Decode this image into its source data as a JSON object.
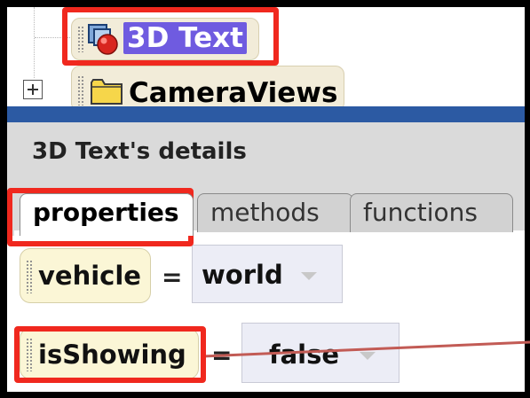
{
  "tree": {
    "items": [
      {
        "label": "3D Text",
        "icon": "3d-object-icon",
        "selected": true
      },
      {
        "label": "CameraViews",
        "icon": "folder-icon",
        "expander": "plus"
      }
    ]
  },
  "details": {
    "title": "3D Text's details",
    "tabs": [
      {
        "label": "properties",
        "active": true
      },
      {
        "label": "methods",
        "active": false
      },
      {
        "label": "functions",
        "active": false
      }
    ],
    "properties": [
      {
        "name": "vehicle",
        "equals": "=",
        "value": "world"
      },
      {
        "name": "isShowing",
        "equals": "=",
        "value": "false"
      }
    ]
  },
  "colors": {
    "highlight": "#f0281e",
    "selection": "#6f5be0",
    "title_bar": "#2c5aa3",
    "annotation_line": "#c25b55"
  }
}
